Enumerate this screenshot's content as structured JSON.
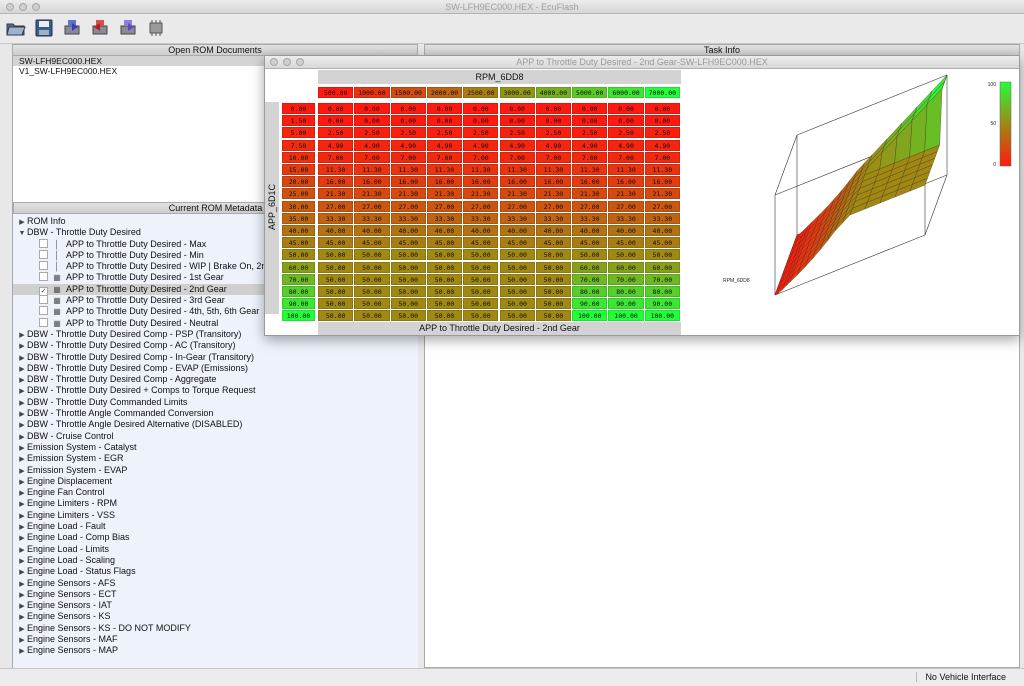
{
  "window": {
    "title": "SW-LFH9EC000.HEX - EcuFlash"
  },
  "toolbar": {
    "buttons": [
      "open-icon",
      "save-icon",
      "read-rom-icon",
      "write-rom-icon",
      "test-write-icon",
      "chip-icon"
    ]
  },
  "rom_docs": {
    "header": "Open ROM Documents",
    "items": [
      "SW-LFH9EC000.HEX",
      "V1_SW-LFH9EC000.HEX"
    ]
  },
  "metadata": {
    "header": "Current ROM Metadata",
    "tree": [
      {
        "label": "ROM Info",
        "level": 0,
        "expanded": false
      },
      {
        "label": "DBW - Throttle Duty Desired",
        "level": 0,
        "expanded": true
      },
      {
        "label": "APP to Throttle Duty Desired - Max",
        "level": 1,
        "icon": "row"
      },
      {
        "label": "APP to Throttle Duty Desired - Min",
        "level": 1,
        "icon": "row"
      },
      {
        "label": "APP to Throttle Duty Desired - WIP | Brake On, 2nd Gear",
        "level": 1,
        "icon": "row"
      },
      {
        "label": "APP to Throttle Duty Desired - 1st Gear",
        "level": 1,
        "icon": "grid"
      },
      {
        "label": "APP to Throttle Duty Desired - 2nd Gear",
        "level": 1,
        "icon": "grid",
        "checked": true,
        "selected": true
      },
      {
        "label": "APP to Throttle Duty Desired - 3rd Gear",
        "level": 1,
        "icon": "grid"
      },
      {
        "label": "APP to Throttle Duty Desired - 4th, 5th, 6th Gear",
        "level": 1,
        "icon": "grid"
      },
      {
        "label": "APP to Throttle Duty Desired - Neutral",
        "level": 1,
        "icon": "grid"
      },
      {
        "label": "DBW - Throttle Duty Desired Comp - PSP (Transitory)",
        "level": 0
      },
      {
        "label": "DBW - Throttle Duty Desired Comp - AC (Transitory)",
        "level": 0
      },
      {
        "label": "DBW - Throttle Duty Desired Comp - In-Gear (Transitory)",
        "level": 0
      },
      {
        "label": "DBW - Throttle Duty Desired Comp - EVAP (Emissions)",
        "level": 0
      },
      {
        "label": "DBW - Throttle Duty Desired Comp - Aggregate",
        "level": 0
      },
      {
        "label": "DBW - Throttle Duty Desired + Comps to Torque Request",
        "level": 0
      },
      {
        "label": "DBW - Throttle Duty Commanded Limits",
        "level": 0
      },
      {
        "label": "DBW - Throttle Angle Commanded Conversion",
        "level": 0
      },
      {
        "label": "DBW - Throttle Angle Desired Alternative (DISABLED)",
        "level": 0
      },
      {
        "label": "DBW - Cruise Control",
        "level": 0
      },
      {
        "label": "Emission System - Catalyst",
        "level": 0
      },
      {
        "label": "Emission System - EGR",
        "level": 0
      },
      {
        "label": "Emission System - EVAP",
        "level": 0
      },
      {
        "label": "Engine Displacement",
        "level": 0
      },
      {
        "label": "Engine Fan Control",
        "level": 0
      },
      {
        "label": "Engine Limiters - RPM",
        "level": 0
      },
      {
        "label": "Engine Limiters - VSS",
        "level": 0
      },
      {
        "label": "Engine Load - Fault",
        "level": 0
      },
      {
        "label": "Engine Load - Comp Bias",
        "level": 0
      },
      {
        "label": "Engine Load - Limits",
        "level": 0
      },
      {
        "label": "Engine Load - Scaling",
        "level": 0
      },
      {
        "label": "Engine Load - Status Flags",
        "level": 0
      },
      {
        "label": "Engine Sensors - AFS",
        "level": 0
      },
      {
        "label": "Engine Sensors - ECT",
        "level": 0
      },
      {
        "label": "Engine Sensors - IAT",
        "level": 0
      },
      {
        "label": "Engine Sensors - KS",
        "level": 0
      },
      {
        "label": "Engine Sensors - KS - DO NOT MODIFY",
        "level": 0
      },
      {
        "label": "Engine Sensors - MAF",
        "level": 0
      },
      {
        "label": "Engine Sensors - MAP",
        "level": 0
      }
    ]
  },
  "task": {
    "header": "Task Info"
  },
  "status": {
    "text": "No Vehicle Interface"
  },
  "table_window": {
    "title": "APP to Throttle Duty Desired - 2nd Gear-SW-LFH9EC000.HEX",
    "x_axis_name": "RPM_6DD8",
    "y_axis_name": "APP_6D1C",
    "footer": "APP to Throttle Duty Desired - 2nd Gear",
    "x_values": [
      "500.00",
      "1000.00",
      "1500.00",
      "2000.00",
      "2500.00",
      "3000.00",
      "4000.00",
      "5000.00",
      "6000.00",
      "7000.00"
    ],
    "y_values": [
      "0.00",
      "1.50",
      "5.00",
      "7.50",
      "10.00",
      "15.00",
      "20.00",
      "25.00",
      "30.00",
      "35.00",
      "40.00",
      "45.00",
      "50.00",
      "60.00",
      "70.00",
      "80.00",
      "90.00",
      "100.00"
    ],
    "rows": [
      [
        "0.00",
        "0.00",
        "0.00",
        "0.00",
        "0.00",
        "0.00",
        "0.00",
        "0.00",
        "0.00",
        "0.00"
      ],
      [
        "0.00",
        "0.00",
        "0.00",
        "0.00",
        "0.00",
        "0.00",
        "0.00",
        "0.00",
        "0.00",
        "0.00"
      ],
      [
        "2.50",
        "2.50",
        "2.50",
        "2.50",
        "2.50",
        "2.50",
        "2.50",
        "2.50",
        "2.50",
        "2.50"
      ],
      [
        "4.90",
        "4.90",
        "4.90",
        "4.90",
        "4.90",
        "4.90",
        "4.90",
        "4.90",
        "4.90",
        "4.90"
      ],
      [
        "7.00",
        "7.00",
        "7.00",
        "7.00",
        "7.00",
        "7.00",
        "7.00",
        "7.00",
        "7.00",
        "7.00"
      ],
      [
        "11.30",
        "11.30",
        "11.30",
        "11.30",
        "11.30",
        "11.30",
        "11.30",
        "11.30",
        "11.30",
        "11.30"
      ],
      [
        "16.00",
        "16.00",
        "16.00",
        "16.00",
        "16.00",
        "16.00",
        "16.00",
        "16.00",
        "16.00",
        "16.00"
      ],
      [
        "21.30",
        "21.30",
        "21.30",
        "21.30",
        "21.30",
        "21.30",
        "21.30",
        "21.30",
        "21.30",
        "21.30"
      ],
      [
        "27.00",
        "27.00",
        "27.00",
        "27.00",
        "27.00",
        "27.00",
        "27.00",
        "27.00",
        "27.00",
        "27.00"
      ],
      [
        "33.30",
        "33.30",
        "33.30",
        "33.30",
        "33.30",
        "33.30",
        "33.30",
        "33.30",
        "33.30",
        "33.30"
      ],
      [
        "40.00",
        "40.00",
        "40.00",
        "40.00",
        "40.00",
        "40.00",
        "40.00",
        "40.00",
        "40.00",
        "40.00"
      ],
      [
        "45.00",
        "45.00",
        "45.00",
        "45.00",
        "45.00",
        "45.00",
        "45.00",
        "45.00",
        "45.00",
        "45.00"
      ],
      [
        "50.00",
        "50.00",
        "50.00",
        "50.00",
        "50.00",
        "50.00",
        "50.00",
        "50.00",
        "50.00",
        "50.00"
      ],
      [
        "50.00",
        "50.00",
        "50.00",
        "50.00",
        "50.00",
        "50.00",
        "50.00",
        "60.00",
        "60.00",
        "60.00"
      ],
      [
        "50.00",
        "50.00",
        "50.00",
        "50.00",
        "50.00",
        "50.00",
        "50.00",
        "70.00",
        "70.00",
        "70.00"
      ],
      [
        "50.00",
        "50.00",
        "50.00",
        "50.00",
        "50.00",
        "50.00",
        "50.00",
        "80.00",
        "80.00",
        "80.00"
      ],
      [
        "50.00",
        "50.00",
        "50.00",
        "50.00",
        "50.00",
        "50.00",
        "50.00",
        "90.00",
        "90.00",
        "90.00"
      ],
      [
        "50.00",
        "50.00",
        "50.00",
        "50.00",
        "50.00",
        "50.00",
        "50.00",
        "100.00",
        "100.00",
        "100.00"
      ]
    ],
    "legend": {
      "max": "100",
      "mid": "50",
      "min": "0"
    },
    "colors": {
      "low": "#ff1a0f",
      "high": "#22ff3a"
    }
  }
}
